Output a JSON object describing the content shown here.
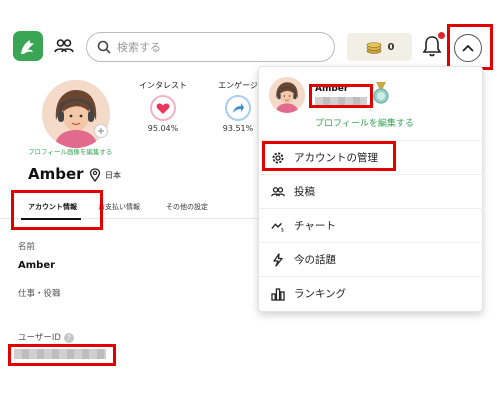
{
  "header": {
    "search_placeholder": "検索する",
    "coin_count": "0"
  },
  "profile": {
    "edit_link": "プロフィール画像を編集する",
    "name": "Amber",
    "location": "日本",
    "stats": [
      {
        "label": "インタレスト",
        "value": "95.04%",
        "color": "#e8365d"
      },
      {
        "label": "エンゲージ",
        "value": "93.51%",
        "color": "#3b8fd8"
      }
    ],
    "tabs": [
      "アカウント情報",
      "お支払い情報",
      "その他の設定"
    ],
    "fields": {
      "name_label": "名前",
      "name_value": "Amber",
      "job_label": "仕事・役職",
      "user_id_label": "ユーザーID",
      "help_glyph": "?"
    }
  },
  "dropdown": {
    "name": "Amber",
    "edit_profile": "プロフィールを編集する",
    "items": [
      {
        "label": "アカウントの管理",
        "icon": "gear-icon"
      },
      {
        "label": "投稿",
        "icon": "people-icon"
      },
      {
        "label": "チャート",
        "icon": "trend-icon"
      },
      {
        "label": "今の話題",
        "icon": "lightning-icon"
      },
      {
        "label": "ランキング",
        "icon": "ranking-icon"
      }
    ]
  },
  "colors": {
    "accent_green": "#36a355",
    "highlight_red": "#e00000",
    "notification_red": "#e3232f"
  }
}
